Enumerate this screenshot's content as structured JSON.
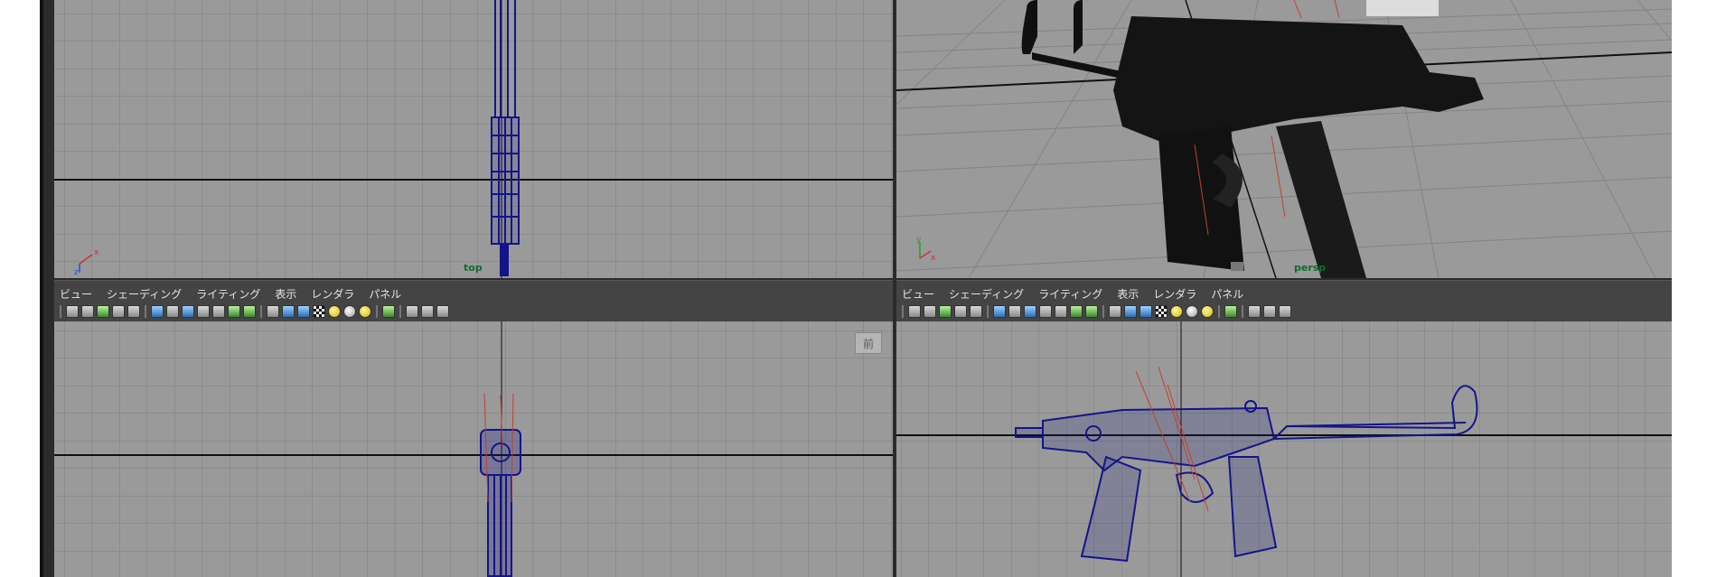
{
  "panel_menu": {
    "items": [
      "ビュー",
      "シェーディング",
      "ライティング",
      "表示",
      "レンダラ",
      "パネル"
    ]
  },
  "viewports": {
    "top": {
      "camera_label": "top"
    },
    "persp": {
      "camera_label": "persp"
    },
    "front": {
      "badge": "前"
    }
  },
  "toolbar_icons": [
    "camera-select-icon",
    "camera-attributes-icon",
    "bookmark-icon",
    "image-plane-icon",
    "2d-pan-zoom-icon",
    "grid-icon",
    "film-gate-icon",
    "resolution-gate-icon",
    "gate-mask-icon",
    "field-chart-icon",
    "safe-action-icon",
    "safe-title-icon",
    "wireframe-icon",
    "smooth-shade-icon",
    "wireframe-on-shaded-icon",
    "textured-icon",
    "lights-icon",
    "shadows-icon",
    "isolate-select-icon",
    "xray-icon",
    "xray-joints-icon"
  ],
  "colors": {
    "viewport_bg": "#9a9a9a",
    "grid_line": "#7d7d7d",
    "axis_line": "#101010",
    "wire_blue": "#14148a",
    "panel_bg": "#444444",
    "camera_label": "#0b6f2b"
  }
}
